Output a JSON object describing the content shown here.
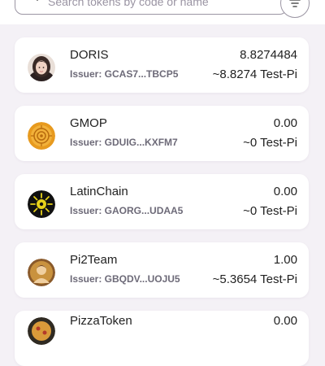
{
  "search": {
    "placeholder": "Search tokens by code or name"
  },
  "tokens": [
    {
      "name": "DORIS",
      "issuer": "Issuer: GCAS7...TBCP5",
      "amount": "8.8274484",
      "value": "~8.8274 Test-Pi",
      "icon": "doris-avatar-icon"
    },
    {
      "name": "GMOP",
      "issuer": "Issuer: GDUIG...KXFM7",
      "amount": "0.00",
      "value": "~0 Test-Pi",
      "icon": "gmop-coin-icon"
    },
    {
      "name": "LatinChain",
      "issuer": "Issuer: GAORG...UDAA5",
      "amount": "0.00",
      "value": "~0 Test-Pi",
      "icon": "latinchain-logo-icon"
    },
    {
      "name": "Pi2Team",
      "issuer": "Issuer: GBQDV...UOJU5",
      "amount": "1.00",
      "value": "~5.3654 Test-Pi",
      "icon": "pi2team-logo-icon"
    },
    {
      "name": "PizzaToken",
      "issuer": "",
      "amount": "0.00",
      "value": "",
      "icon": "pizzatoken-logo-icon"
    }
  ]
}
